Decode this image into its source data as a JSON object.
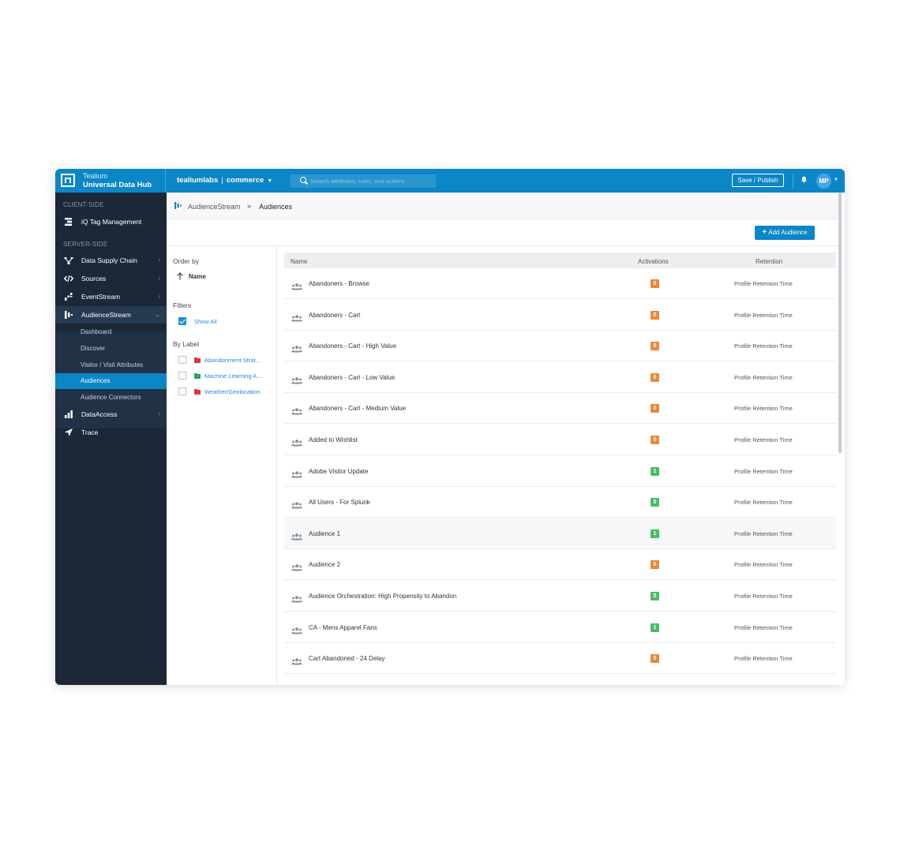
{
  "header": {
    "brand_line1": "Tealium",
    "brand_line2": "Universal Data Hub",
    "account": "tealiumlabs",
    "separator": "|",
    "profile": "commerce",
    "search_placeholder": "Search attributes, rules, and actions",
    "save_publish": "Save / Publish",
    "avatar_initials": "MP",
    "accent_color": "#0b86c6"
  },
  "sidebar": {
    "client_side_label": "CLIENT-SIDE",
    "server_side_label": "SERVER-SIDE",
    "items": [
      {
        "label": "iQ Tag Management",
        "icon": "tag-management-icon"
      },
      {
        "label": "Data Supply Chain",
        "icon": "data-supply-chain-icon"
      },
      {
        "label": "Sources",
        "icon": "code-icon"
      },
      {
        "label": "EventStream",
        "icon": "eventstream-icon"
      },
      {
        "label": "AudienceStream",
        "icon": "audiencestream-icon"
      },
      {
        "label": "DataAccess",
        "icon": "bar-chart-icon"
      },
      {
        "label": "Trace",
        "icon": "location-arrow-icon"
      }
    ],
    "sub_items": [
      {
        "label": "Dashboard"
      },
      {
        "label": "Discover"
      },
      {
        "label": "Visitor / Visit Attributes"
      },
      {
        "label": "Audiences"
      },
      {
        "label": "Audience Connectors"
      }
    ]
  },
  "breadcrumb": {
    "parent": "AudienceStream",
    "separator": "»",
    "current": "Audiences"
  },
  "toolbar": {
    "add_audience": "Add Audience"
  },
  "filters": {
    "order_by_label": "Order by",
    "order_by_value": "Name",
    "filters_label": "Filters",
    "show_all": "Show All",
    "by_label": "By Label",
    "labels": [
      {
        "text": "Abandonment Strat...",
        "color": "#d9363e"
      },
      {
        "text": "Machine Learning A...",
        "color": "#23a55a"
      },
      {
        "text": "Weather/Geolocation",
        "color": "#d9363e"
      }
    ]
  },
  "table": {
    "columns": [
      "Name",
      "Activations",
      "Retention"
    ],
    "rows": [
      {
        "name": "Abandoners - Browse",
        "activations": "0",
        "retention": "Profile Retention Time"
      },
      {
        "name": "Abandoners - Cart",
        "activations": "0",
        "retention": "Profile Retention Time"
      },
      {
        "name": "Abandoners - Cart - High Value",
        "activations": "0",
        "retention": "Profile Retention Time"
      },
      {
        "name": "Abandoners - Cart - Low Value",
        "activations": "0",
        "retention": "Profile Retention Time"
      },
      {
        "name": "Abandoners - Cart - Medium Value",
        "activations": "0",
        "retention": "Profile Retention Time"
      },
      {
        "name": "Added to Wishlist",
        "activations": "0",
        "retention": "Profile Retention Time"
      },
      {
        "name": "Adobe Visitor Update",
        "activations": "1",
        "retention": "Profile Retention Time"
      },
      {
        "name": "All Users - For Splunk",
        "activations": "5",
        "retention": "Profile Retention Time"
      },
      {
        "name": "Audience 1",
        "activations": "1",
        "retention": "Profile Retention Time"
      },
      {
        "name": "Audience 2",
        "activations": "0",
        "retention": "Profile Retention Time"
      },
      {
        "name": "Audience Orchestration: High Propensity to Abandon",
        "activations": "5",
        "retention": "Profile Retention Time"
      },
      {
        "name": "CA - Mens Apparel Fans",
        "activations": "1",
        "retention": "Profile Retention Time"
      },
      {
        "name": "Cart Abandoned - 24 Delay",
        "activations": "0",
        "retention": "Profile Retention Time"
      }
    ],
    "zero_color": "#e58a3c",
    "active_color": "#4cba6a"
  }
}
